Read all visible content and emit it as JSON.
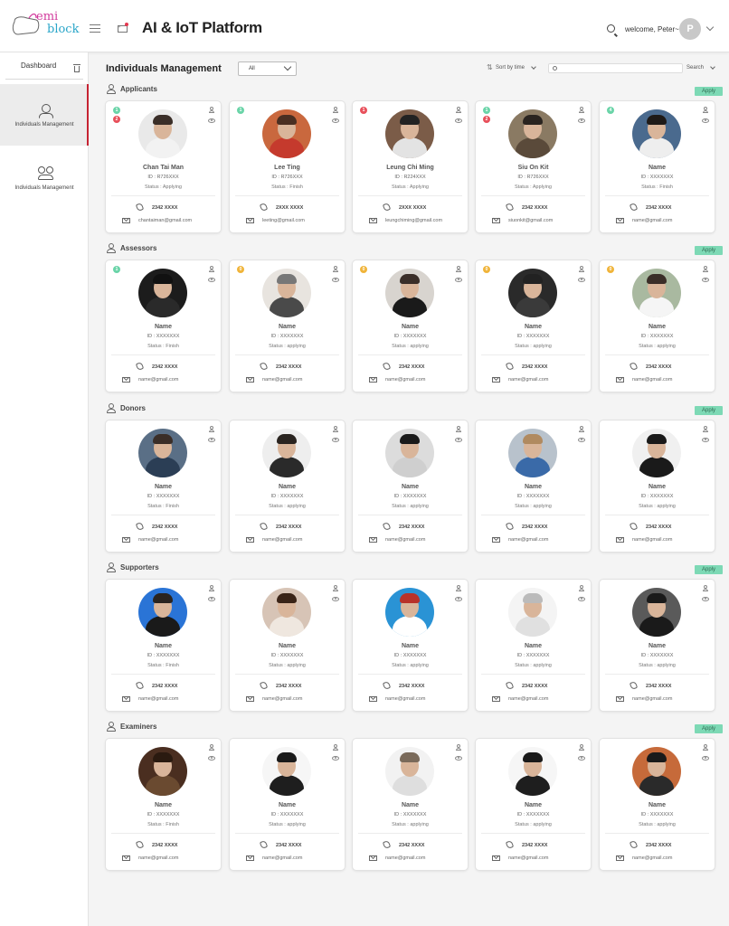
{
  "header": {
    "logo_line1": "emi",
    "logo_line2": "block",
    "title": "AI & IoT Platform",
    "welcome": "welcome, Peter~",
    "avatar_initial": "P"
  },
  "sidebar": {
    "dashboard_label": "Dashboard",
    "items": [
      {
        "label": "Individuals Management",
        "active": true
      },
      {
        "label": "Individuals Management",
        "active": false
      }
    ]
  },
  "toolbar": {
    "page_title": "Individuals Management",
    "filter_value": "All",
    "sort_label": "Sort by time",
    "search_placeholder": "",
    "search_label": "Search"
  },
  "apply_label": "Apply",
  "colors": {
    "accent_red": "#c62333",
    "apply_green": "#7dd9b5",
    "badge_green": "#6ad4a8",
    "badge_red": "#e8505b",
    "badge_orange": "#f0b43a"
  },
  "sections": [
    {
      "title": "Applicants",
      "cards": [
        {
          "badges": [
            {
              "n": "1",
              "c": "green"
            },
            {
              "n": "2",
              "c": "red"
            }
          ],
          "name": "Chan Tai Man",
          "id": "ID : R726XXX",
          "status": "Status : Applying",
          "phone": "2342 XXXX",
          "email": "chantaiman@gmail.com",
          "bg": "#e9e9e9",
          "shirt": "#f2f2f2",
          "hair": "#3a2e28"
        },
        {
          "badges": [
            {
              "n": "1",
              "c": "green"
            }
          ],
          "name": "Lee Ting",
          "id": "ID : R726XXX",
          "status": "Status : Finish",
          "phone": "2XXX XXXX",
          "email": "leeting@gmail.com",
          "bg": "#c9683e",
          "shirt": "#c53a2d",
          "hair": "#4a2f22"
        },
        {
          "badges": [
            {
              "n": "1",
              "c": "red"
            }
          ],
          "name": "Leung Chi Ming",
          "id": "ID : R224XXX",
          "status": "Status : Applying",
          "phone": "2XXX XXXX",
          "email": "leungchiming@gmail.com",
          "bg": "#7b5c48",
          "shirt": "#e3e3e3",
          "hair": "#222"
        },
        {
          "badges": [
            {
              "n": "1",
              "c": "green"
            },
            {
              "n": "2",
              "c": "red"
            }
          ],
          "name": "Siu On Kit",
          "id": "ID : R726XXX",
          "status": "Status : Applying",
          "phone": "2342 XXXX",
          "email": "siuonkit@gmail.com",
          "bg": "#8a7a63",
          "shirt": "#5a4a3a",
          "hair": "#2a2420"
        },
        {
          "badges": [
            {
              "n": "4",
              "c": "green"
            }
          ],
          "name": "Name",
          "id": "ID : XXXXXXX",
          "status": "Status : Finish",
          "phone": "2342 XXXX",
          "email": "name@gmail.com",
          "bg": "#4a6a8e",
          "shirt": "#eeeeee",
          "hair": "#1e1a18"
        }
      ]
    },
    {
      "title": "Assessors",
      "cards": [
        {
          "badges": [
            {
              "n": "1",
              "c": "green"
            }
          ],
          "name": "Name",
          "id": "ID : XXXXXXX",
          "status": "Status : Finish",
          "phone": "2342 XXXX",
          "email": "name@gmail.com",
          "bg": "#1c1c1c",
          "shirt": "#2a2a2a",
          "hair": "#111"
        },
        {
          "badges": [
            {
              "n": "0",
              "c": "orange"
            }
          ],
          "name": "Name",
          "id": "ID : XXXXXXX",
          "status": "Status : applying",
          "phone": "2342 XXXX",
          "email": "name@gmail.com",
          "bg": "#e8e4df",
          "shirt": "#4a4a4a",
          "hair": "#777"
        },
        {
          "badges": [
            {
              "n": "0",
              "c": "orange"
            }
          ],
          "name": "Name",
          "id": "ID : XXXXXXX",
          "status": "Status : applying",
          "phone": "2342 XXXX",
          "email": "name@gmail.com",
          "bg": "#d8d4cf",
          "shirt": "#1a1a1a",
          "hair": "#3a2e28"
        },
        {
          "badges": [
            {
              "n": "0",
              "c": "orange"
            }
          ],
          "name": "Name",
          "id": "ID : XXXXXXX",
          "status": "Status : applying",
          "phone": "2342 XXXX",
          "email": "name@gmail.com",
          "bg": "#2a2a2a",
          "shirt": "#3a3a3a",
          "hair": "#222"
        },
        {
          "badges": [
            {
              "n": "0",
              "c": "orange"
            }
          ],
          "name": "Name",
          "id": "ID : XXXXXXX",
          "status": "Status : applying",
          "phone": "2342 XXXX",
          "email": "name@gmail.com",
          "bg": "#a9b9a0",
          "shirt": "#f5f5f5",
          "hair": "#3a2e28"
        }
      ]
    },
    {
      "title": "Donors",
      "cards": [
        {
          "badges": [],
          "name": "Name",
          "id": "ID : XXXXXXX",
          "status": "Status : Finish",
          "phone": "2342 XXXX",
          "email": "name@gmail.com",
          "bg": "#5a6f86",
          "shirt": "#2b3e55",
          "hair": "#3a2e28"
        },
        {
          "badges": [],
          "name": "Name",
          "id": "ID : XXXXXXX",
          "status": "Status : applying",
          "phone": "2342 XXXX",
          "email": "name@gmail.com",
          "bg": "#eeeeee",
          "shirt": "#2a2a2a",
          "hair": "#2a2420"
        },
        {
          "badges": [],
          "name": "Name",
          "id": "ID : XXXXXXX",
          "status": "Status : applying",
          "phone": "2342 XXXX",
          "email": "name@gmail.com",
          "bg": "#dcdcdc",
          "shirt": "#cfcfcf",
          "hair": "#1a1a1a"
        },
        {
          "badges": [],
          "name": "Name",
          "id": "ID : XXXXXXX",
          "status": "Status : applying",
          "phone": "2342 XXXX",
          "email": "name@gmail.com",
          "bg": "#b8c2cc",
          "shirt": "#3a6aa8",
          "hair": "#b08a60"
        },
        {
          "badges": [],
          "name": "Name",
          "id": "ID : XXXXXXX",
          "status": "Status : applying",
          "phone": "2342 XXXX",
          "email": "name@gmail.com",
          "bg": "#f0f0f0",
          "shirt": "#1a1a1a",
          "hair": "#1a1a1a"
        }
      ]
    },
    {
      "title": "Supporters",
      "cards": [
        {
          "badges": [],
          "name": "Name",
          "id": "ID : XXXXXXX",
          "status": "Status : Finish",
          "phone": "2342 XXXX",
          "email": "name@gmail.com",
          "bg": "#2a74d6",
          "shirt": "#1a1a1a",
          "hair": "#2a2420"
        },
        {
          "badges": [],
          "name": "Name",
          "id": "ID : XXXXXXX",
          "status": "Status : applying",
          "phone": "2342 XXXX",
          "email": "name@gmail.com",
          "bg": "#d7c4b6",
          "shirt": "#efe7df",
          "hair": "#3a2417"
        },
        {
          "badges": [],
          "name": "Name",
          "id": "ID : XXXXXXX",
          "status": "Status : applying",
          "phone": "2342 XXXX",
          "email": "name@gmail.com",
          "bg": "#2a93d5",
          "shirt": "#ffffff",
          "hair": "#b8322a"
        },
        {
          "badges": [],
          "name": "Name",
          "id": "ID : XXXXXXX",
          "status": "Status : applying",
          "phone": "2342 XXXX",
          "email": "name@gmail.com",
          "bg": "#f4f4f4",
          "shirt": "#e0e0e0",
          "hair": "#bbbbbb"
        },
        {
          "badges": [],
          "name": "Name",
          "id": "ID : XXXXXXX",
          "status": "Status : applying",
          "phone": "2342 XXXX",
          "email": "name@gmail.com",
          "bg": "#5a5a5a",
          "shirt": "#1a1a1a",
          "hair": "#1a1a1a"
        }
      ]
    },
    {
      "title": "Examiners",
      "cards": [
        {
          "badges": [],
          "name": "Name",
          "id": "ID : XXXXXXX",
          "status": "Status : Finish",
          "phone": "2342 XXXX",
          "email": "name@gmail.com",
          "bg": "#4a2e20",
          "shirt": "#6a4a30",
          "hair": "#2a1a10"
        },
        {
          "badges": [],
          "name": "Name",
          "id": "ID : XXXXXXX",
          "status": "Status : applying",
          "phone": "2342 XXXX",
          "email": "name@gmail.com",
          "bg": "#f6f6f6",
          "shirt": "#1e1e1e",
          "hair": "#1a1a1a"
        },
        {
          "badges": [],
          "name": "Name",
          "id": "ID : XXXXXXX",
          "status": "Status : applying",
          "phone": "2342 XXXX",
          "email": "name@gmail.com",
          "bg": "#f2f2f2",
          "shirt": "#dedede",
          "hair": "#7a6a5a"
        },
        {
          "badges": [],
          "name": "Name",
          "id": "ID : XXXXXXX",
          "status": "Status : applying",
          "phone": "2342 XXXX",
          "email": "name@gmail.com",
          "bg": "#f6f6f6",
          "shirt": "#1e1e1e",
          "hair": "#1a1a1a"
        },
        {
          "badges": [],
          "name": "Name",
          "id": "ID : XXXXXXX",
          "status": "Status : applying",
          "phone": "2342 XXXX",
          "email": "name@gmail.com",
          "bg": "#c66a3a",
          "shirt": "#2a2a2a",
          "hair": "#1a1a1a"
        }
      ]
    }
  ]
}
